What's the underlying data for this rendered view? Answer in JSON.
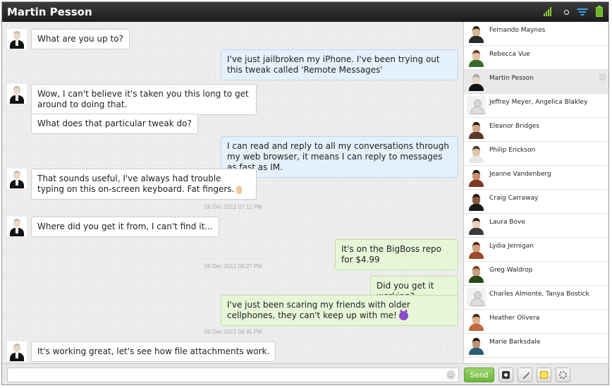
{
  "header": {
    "title": "Martin Pesson"
  },
  "messages": [
    {
      "text": "What are you up to?"
    },
    {
      "text": "I've just jailbroken my iPhone. I've been trying out this tweak called 'Remote Messages'"
    },
    {
      "text": "Wow, I can't believe it's taken you this long to get around to doing that."
    },
    {
      "text": "What does that particular tweak do?"
    },
    {
      "text": "I can read and reply to all my conversations through my web browser, it means I can reply to messages as fast as IM."
    },
    {
      "text": "That sounds useful, I've always had trouble typing on this on-screen keyboard. Fat fingers."
    },
    {
      "text": "Where did you get it from, I can't find it..."
    },
    {
      "text": "It's on the BigBoss repo for $4.99"
    },
    {
      "text": "Did you get it working?"
    },
    {
      "text": "I've just been scaring my friends with older cellphones, they can't keep up with me!"
    },
    {
      "text": "It's working great, let's see how file attachments work."
    }
  ],
  "timestamps": [
    "06 Dec 2012 07:12 PM",
    "06 Dec 2012 08:27 PM",
    "06 Dec 2012 08:45 PM"
  ],
  "contacts": [
    {
      "name": "Fernando Maynes"
    },
    {
      "name": "Rebecca Vue"
    },
    {
      "name": "Martin Pesson",
      "active": true
    },
    {
      "name": "Jeffrey Meyer, Angelica Blakley",
      "group": true
    },
    {
      "name": "Eleanor Bridges"
    },
    {
      "name": "Philip Erickson"
    },
    {
      "name": "Jeanne Vandenberg"
    },
    {
      "name": "Craig Carraway"
    },
    {
      "name": "Laura Bove"
    },
    {
      "name": "Lydia Jernigan"
    },
    {
      "name": "Greg Waldrop"
    },
    {
      "name": "Charles Almonte, Tanya Bostick",
      "group": true
    },
    {
      "name": "Heather Olivera"
    },
    {
      "name": "Marie Barksdale"
    }
  ],
  "composer": {
    "placeholder": "",
    "send_label": "Send"
  },
  "sidebar": {
    "close_glyph": "×"
  },
  "icons": {
    "status": [
      "signal-icon",
      "circle-icon",
      "wifi-icon",
      "battery-icon"
    ],
    "tools": [
      "camera-icon",
      "pencil-icon",
      "note-icon",
      "settings-icon"
    ],
    "composer": "smiley-icon"
  },
  "colors": {
    "outgoing_blue": "#e4f0fb",
    "outgoing_green": "#e8f6d8",
    "send_green": "#6bb53c",
    "titlebar": "#1c1c1c"
  }
}
